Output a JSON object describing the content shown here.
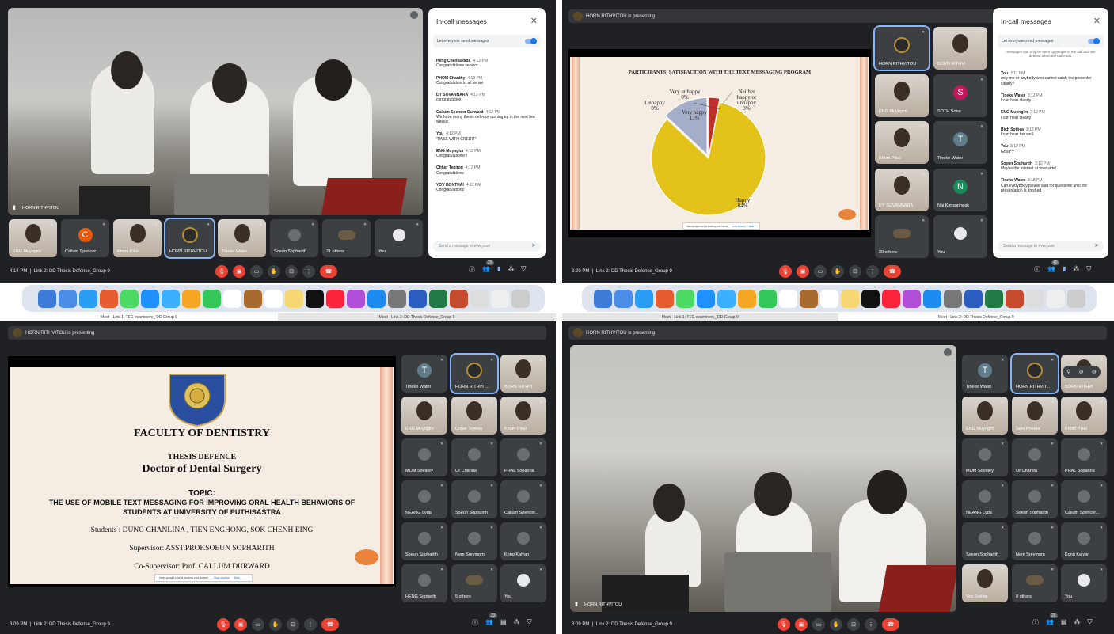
{
  "q1": {
    "speaker_name": "HORN RITHVITOU",
    "tiles": [
      {
        "name": "ENG Muyngim"
      },
      {
        "name": "Callum Spencer ...",
        "initial": "C",
        "color": "#e8590c"
      },
      {
        "name": "Khom Pisal"
      },
      {
        "name": "HORN RITHVITOU"
      },
      {
        "name": "Tineke Water"
      },
      {
        "name": "Soeun Sopharith"
      },
      {
        "name": "21 others"
      },
      {
        "name": "You"
      }
    ],
    "chat": {
      "title": "In-call messages",
      "toggle": "Let everyone send messages",
      "messages": [
        {
          "sender": "Heng Chansakada",
          "time": "4:12 PM",
          "text": "Congratulations seniors"
        },
        {
          "sender": "PHOM Chanthy",
          "time": "4:12 PM",
          "text": "Congratulation to all senior"
        },
        {
          "sender": "DY SOVANNARA",
          "time": "4:12 PM",
          "text": "congratulation"
        },
        {
          "sender": "Callum Spencer Durward",
          "time": "4:12 PM",
          "text": "We have many thesis defence coming up in the next few weeks!"
        },
        {
          "sender": "You",
          "time": "4:12 PM",
          "text": "\"PASS WITH CREDIT\""
        },
        {
          "sender": "ENG Muyngim",
          "time": "4:12 PM",
          "text": "Congratulations!!!"
        },
        {
          "sender": "Chher Tepirou",
          "time": "4:12 PM",
          "text": "Congratulations"
        },
        {
          "sender": "YOV BONTHAI",
          "time": "4:13 PM",
          "text": "Congratulations"
        }
      ],
      "placeholder": "Send a message to everyone"
    },
    "clock": "4:14 PM",
    "meeting": "Link 2: DD Thesis Defense_Group 9",
    "people_count": "29"
  },
  "q2": {
    "presenting": "HORN RITHVITOU is presenting",
    "chart_data": {
      "type": "pie",
      "title": "PARTICIPANTS' SATISFACTION WITH THE TEXT MESSAGING PROGRAM",
      "slices": [
        {
          "label": "Happy",
          "percent_label": "84%",
          "value": 84,
          "color": "#e3c319"
        },
        {
          "label": "Very happy",
          "percent_label": "13%",
          "value": 13,
          "color": "#a5aec8"
        },
        {
          "label": "Neither happy or unhappy",
          "percent_label": "3%",
          "value": 3,
          "color": "#c0302a"
        },
        {
          "label": "Very unhappy",
          "percent_label": "0%",
          "value": 0,
          "color": "#999999"
        },
        {
          "label": "Unhappy",
          "percent_label": "0%",
          "value": 0,
          "color": "#777777"
        }
      ]
    },
    "share_bar": {
      "text": "meet.google.com is sharing your screen.",
      "stop": "Stop sharing",
      "hide": "Hide"
    },
    "tiles": [
      {
        "name": "HORN RITHVITOU"
      },
      {
        "name": "BORN RITHVI"
      },
      {
        "name": "ENG Muyngim"
      },
      {
        "name": "SOTH Sona",
        "initial": "S",
        "color": "#c2185b"
      },
      {
        "name": "Khom Pisal"
      },
      {
        "name": "Tineke Water",
        "initial": "T",
        "color": "#607d8b"
      },
      {
        "name": "DY SOVANNARA"
      },
      {
        "name": "Nai Kimsopheak",
        "initial": "N",
        "color": "#1b8a5a"
      },
      {
        "name": "30 others"
      },
      {
        "name": "You"
      }
    ],
    "chat": {
      "title": "In-call messages",
      "toggle": "Let everyone send messages",
      "notice": "messages can only be seen by people in the call and are deleted when the call ends.",
      "messages": [
        {
          "sender": "You",
          "time": "3:11 PM",
          "text": "only me or anybody who cannot catch the presenter clearly?"
        },
        {
          "sender": "Tineke Water",
          "time": "3:12 PM",
          "text": "I can hear clearly"
        },
        {
          "sender": "ENG Muyngim",
          "time": "3:12 PM",
          "text": "I can hear clearly"
        },
        {
          "sender": "Bich Sothea",
          "time": "3:12 PM",
          "text": "I can hear her well."
        },
        {
          "sender": "You",
          "time": "3:12 PM",
          "text": "Good^^"
        },
        {
          "sender": "Soeun Sopharith",
          "time": "3:12 PM",
          "text": "Maybe the internet at your side!"
        },
        {
          "sender": "Tineke Water",
          "time": "3:18 PM",
          "text": "Can everybody please wait for questions until the presentation is finished."
        }
      ],
      "placeholder": "Send a message to everyone"
    },
    "clock": "3:20 PM",
    "meeting": "Link 2: DD Thesis Defense_Group 9",
    "people_count": "40"
  },
  "tabs": {
    "left": "Meet - Link 1: TEC examiners_ DD Group 9",
    "right": "Meet - Link 2: DD Thesis Defense_Group 9"
  },
  "q3": {
    "presenting": "HORN RITHVITOU is presenting",
    "slide": {
      "faculty": "FACULTY OF DENTISTRY",
      "thesis": "THESIS DEFENCE",
      "degree": "Doctor of Dental Surgery",
      "topic_label": "TOPIC:",
      "topic1": "THE USE OF MOBILE TEXT MESSAGING FOR IMPROVING ORAL HEALTH BEHAVIORS OF",
      "topic2": "STUDENTS AT UNIVERSITY OF PUTHISASTRA",
      "students": "Students : DUNG CHANLINA , TIEN ENGHONG, SOK CHENH EING",
      "supervisor": "Supervisor: ASST.PROF.SOEUN SOPHARITH",
      "cosupervisor": "Co-Supervisor: Prof. CALLUM DURWARD"
    },
    "share_bar": {
      "text": "meet.google.com is sharing your screen.",
      "stop": "Stop sharing",
      "hide": "Hide"
    },
    "tiles": [
      {
        "name": "Tineke Water",
        "initial": "T",
        "color": "#607d8b"
      },
      {
        "name": "HORN RITHVIT..."
      },
      {
        "name": "BORN RITHVI"
      },
      {
        "name": "ENG Muyngim"
      },
      {
        "name": "Chher Tepirou"
      },
      {
        "name": "Khom Pisal"
      },
      {
        "name": "MOM Sovatey"
      },
      {
        "name": "Or Chanda"
      },
      {
        "name": "PHAL Sopanha"
      },
      {
        "name": "NEANG Lyda"
      },
      {
        "name": "Soeun Sopharith"
      },
      {
        "name": "Callum Spencer..."
      },
      {
        "name": "Soeun Sopharith"
      },
      {
        "name": "Nem Sreymom"
      },
      {
        "name": "Kong Kalyan"
      },
      {
        "name": "HENG Sopiseth"
      },
      {
        "name": "5 others"
      },
      {
        "name": "You"
      }
    ],
    "clock": "3:09 PM",
    "meeting": "Link 2: DD Thesis Defense_Group 9",
    "people_count": "23"
  },
  "q4": {
    "presenting": "HORN RITHVITOU is presenting",
    "speaker_name": "HORN RITHVITOU",
    "tiles": [
      {
        "name": "Tineke Water",
        "initial": "T",
        "color": "#607d8b"
      },
      {
        "name": "HORN RITHVIT..."
      },
      {
        "name": "BORN RITHVI"
      },
      {
        "name": "ENG Muyngim"
      },
      {
        "name": "Sem Pheara"
      },
      {
        "name": "Khom Pisal"
      },
      {
        "name": "MOM Sovatey"
      },
      {
        "name": "Or Chanda"
      },
      {
        "name": "PHAL Sopanha"
      },
      {
        "name": "NEANG Lyda"
      },
      {
        "name": "Soeun Sopharith"
      },
      {
        "name": "Callum Spencer..."
      },
      {
        "name": "Soeun Sopharith"
      },
      {
        "name": "Nem Sreymom"
      },
      {
        "name": "Kong Kalyan"
      },
      {
        "name": "Vou Soklay"
      },
      {
        "name": "8 others"
      },
      {
        "name": "You"
      }
    ],
    "clock": "3:09 PM",
    "meeting": "Link 2: DD Thesis Defense_Group 9",
    "people_count": "26"
  },
  "dock_colors": [
    "#3d7bd9",
    "#4a8ee8",
    "#2a9df4",
    "#e85d2f",
    "#4cd964",
    "#1e90ff",
    "#3ab0ff",
    "#f5a623",
    "#34c759",
    "#ffffff",
    "#a86b2d",
    "#ffffff",
    "#f7d774",
    "#111111",
    "#fa233b",
    "#b04ed8",
    "#1c8cf0",
    "#777777",
    "#2b5cbf",
    "#1f7a44",
    "#c64b2e",
    "#dddddd",
    "#eeeeee",
    "#cccccc"
  ]
}
